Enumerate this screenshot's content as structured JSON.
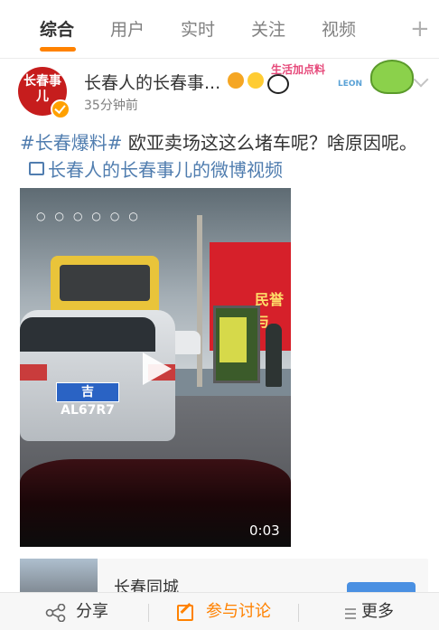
{
  "tabs": [
    {
      "label": "综合",
      "active": true
    },
    {
      "label": "用户",
      "active": false
    },
    {
      "label": "实时",
      "active": false
    },
    {
      "label": "关注",
      "active": false
    },
    {
      "label": "视频",
      "active": false
    }
  ],
  "tab_add_symbol": "+",
  "colors": {
    "accent": "#ff8200",
    "link": "#507daf",
    "avatar_bg": "#c61d1d"
  },
  "post": {
    "avatar_text": "长春事儿",
    "username": "长春人的长春事...",
    "timestamp": "35分钟前",
    "hashtag": "#长春爆料#",
    "text": "欧亚卖场这这么堵车呢？啥原因呢。",
    "video_link": "长春人的长春事儿的微博视频",
    "badge_sticker_text": "生活加点料",
    "badge_sticker_sub": "LEON"
  },
  "video": {
    "duration": "0:03",
    "plate": "吉AL67R7",
    "building_text": "民誉与"
  },
  "card": {
    "title": "长春同城"
  },
  "actions": {
    "share": "分享",
    "discuss": "参与讨论",
    "more": "更多"
  }
}
